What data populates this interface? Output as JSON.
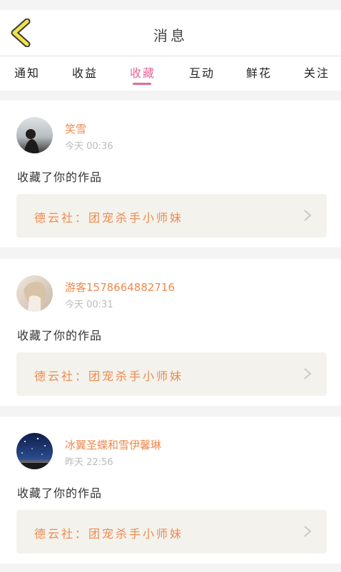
{
  "header": {
    "title": "消息"
  },
  "tabs": [
    {
      "label": "通知"
    },
    {
      "label": "收益"
    },
    {
      "label": "收藏"
    },
    {
      "label": "互动"
    },
    {
      "label": "鲜花"
    },
    {
      "label": "关注"
    }
  ],
  "active_tab": "收藏",
  "colors": {
    "accent": "#e8689a",
    "name": "#ee8a4e",
    "back_icon": "#f2e24a"
  },
  "messages": [
    {
      "user": "笑雪",
      "time": "今天 00:36",
      "action": "收藏了你的作品",
      "work": "德云社：团宠杀手小师妹"
    },
    {
      "user": "游客1578664882716",
      "time": "今天 00:31",
      "action": "收藏了你的作品",
      "work": "德云社：团宠杀手小师妹"
    },
    {
      "user": "冰翼圣蝶和雪伊馨琳",
      "time": "昨天 22:56",
      "action": "收藏了你的作品",
      "work": "德云社：团宠杀手小师妹"
    }
  ]
}
